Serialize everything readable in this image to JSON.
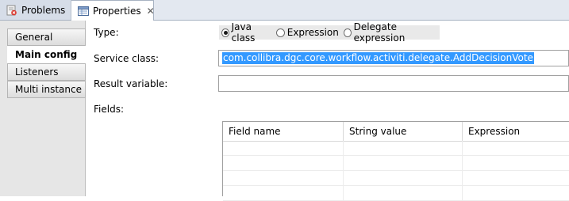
{
  "tabs": {
    "problems": {
      "label": "Problems",
      "icon": "problems-icon"
    },
    "properties": {
      "label": "Properties",
      "icon": "properties-icon",
      "close_symbol": "✕"
    }
  },
  "sidebar": {
    "items": [
      {
        "label": "General",
        "selected": false
      },
      {
        "label": "Main config",
        "selected": true
      },
      {
        "label": "Listeners",
        "selected": false
      },
      {
        "label": "Multi instance",
        "selected": false
      }
    ]
  },
  "form": {
    "type_label": "Type:",
    "type_options": [
      {
        "label": "Java class",
        "checked": true
      },
      {
        "label": "Expression",
        "checked": false
      },
      {
        "label": "Delegate expression",
        "checked": false
      }
    ],
    "service_class_label": "Service class:",
    "service_class_value": "com.collibra.dgc.core.workflow.activiti.delegate.AddDecisionVote",
    "result_variable_label": "Result variable:",
    "result_variable_value": "",
    "fields_label": "Fields:"
  },
  "fields_table": {
    "columns": [
      "Field name",
      "String value",
      "Expression"
    ],
    "rows": [
      [
        "",
        "",
        ""
      ],
      [
        "",
        "",
        ""
      ],
      [
        "",
        "",
        ""
      ],
      [
        "",
        "",
        ""
      ]
    ]
  },
  "colors": {
    "selection": "#3399ff",
    "tab_strip": "#e3e8f0"
  }
}
